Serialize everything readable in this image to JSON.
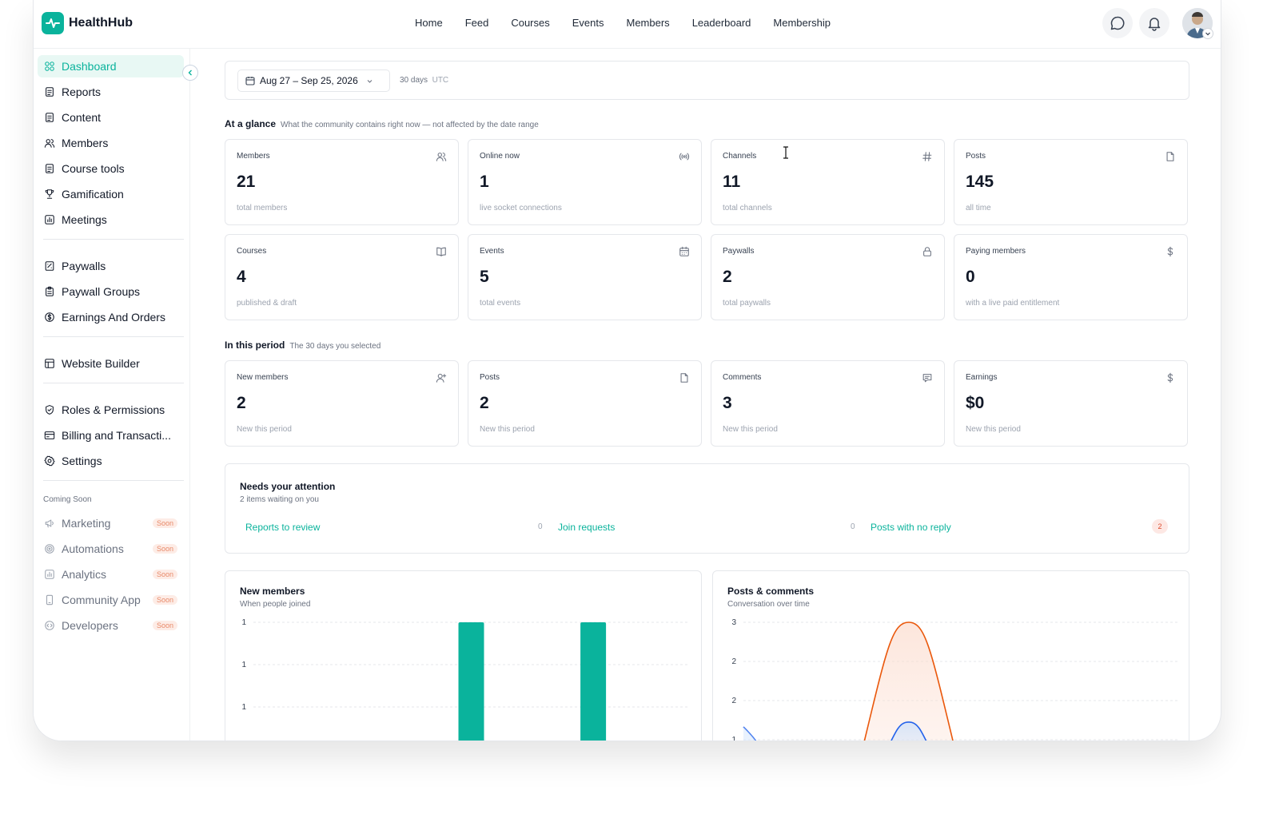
{
  "app": {
    "name": "HealthHub"
  },
  "nav": [
    "Home",
    "Feed",
    "Courses",
    "Events",
    "Members",
    "Leaderboard",
    "Membership"
  ],
  "header": {
    "chat_icon": "chat-bubble-icon",
    "bell_icon": "bell-icon"
  },
  "sidebar": {
    "groups": [
      [
        {
          "label": "Dashboard",
          "icon": "grid-icon",
          "active": true
        },
        {
          "label": "Reports",
          "icon": "document-icon"
        },
        {
          "label": "Content",
          "icon": "document-icon"
        },
        {
          "label": "Members",
          "icon": "users-icon"
        },
        {
          "label": "Course tools",
          "icon": "document-icon"
        },
        {
          "label": "Gamification",
          "icon": "trophy-icon"
        },
        {
          "label": "Meetings",
          "icon": "chart-icon"
        }
      ],
      [
        {
          "label": "Paywalls",
          "icon": "paywall-icon"
        },
        {
          "label": "Paywall Groups",
          "icon": "clipboard-icon"
        },
        {
          "label": "Earnings And Orders",
          "icon": "dollar-circle-icon"
        }
      ],
      [
        {
          "label": "Website Builder",
          "icon": "layout-icon"
        }
      ],
      [
        {
          "label": "Roles & Permissions",
          "icon": "shield-icon"
        },
        {
          "label": "Billing and Transacti...",
          "icon": "card-icon"
        },
        {
          "label": "Settings",
          "icon": "gear-icon"
        }
      ]
    ],
    "coming_soon_title": "Coming Soon",
    "soon_label": "Soon",
    "coming_soon": [
      {
        "label": "Marketing",
        "icon": "megaphone-icon"
      },
      {
        "label": "Automations",
        "icon": "target-icon"
      },
      {
        "label": "Analytics",
        "icon": "chart-icon"
      },
      {
        "label": "Community App",
        "icon": "phone-icon"
      },
      {
        "label": "Developers",
        "icon": "code-icon"
      }
    ]
  },
  "datebar": {
    "range": "Aug 27 – Sep 25, 2026",
    "days": "30 days",
    "tz": "UTC"
  },
  "glance": {
    "title": "At a glance",
    "subtitle": "What the community contains right now — not affected by the date range",
    "stats": [
      {
        "label": "Members",
        "value": "21",
        "sub": "total members",
        "icon": "users-icon"
      },
      {
        "label": "Online now",
        "value": "1",
        "sub": "live socket connections",
        "icon": "broadcast-icon"
      },
      {
        "label": "Channels",
        "value": "11",
        "sub": "total channels",
        "icon": "hash-icon"
      },
      {
        "label": "Posts",
        "value": "145",
        "sub": "all time",
        "icon": "file-icon"
      },
      {
        "label": "Courses",
        "value": "4",
        "sub": "published & draft",
        "icon": "book-icon"
      },
      {
        "label": "Events",
        "value": "5",
        "sub": "total events",
        "icon": "calendar-icon"
      },
      {
        "label": "Paywalls",
        "value": "2",
        "sub": "total paywalls",
        "icon": "lock-icon"
      },
      {
        "label": "Paying members",
        "value": "0",
        "sub": "with a live paid entitlement",
        "icon": "dollar-icon"
      }
    ]
  },
  "period": {
    "title": "In this period",
    "subtitle": "The 30 days you selected",
    "stats": [
      {
        "label": "New members",
        "value": "2",
        "sub": "New this period",
        "icon": "user-plus-icon"
      },
      {
        "label": "Posts",
        "value": "2",
        "sub": "New this period",
        "icon": "file-icon"
      },
      {
        "label": "Comments",
        "value": "3",
        "sub": "New this period",
        "icon": "comment-icon"
      },
      {
        "label": "Earnings",
        "value": "$0",
        "sub": "New this period",
        "icon": "dollar-icon"
      }
    ]
  },
  "attention": {
    "title": "Needs your attention",
    "subtitle": "2 items waiting on you",
    "items": [
      {
        "label": "Reports to review",
        "count": "0",
        "badge": false
      },
      {
        "label": "Join requests",
        "count": "0",
        "badge": false
      },
      {
        "label": "Posts with no reply",
        "count": "2",
        "badge": true
      }
    ]
  },
  "charts": {
    "members": {
      "title": "New members",
      "subtitle": "When people joined"
    },
    "posts": {
      "title": "Posts & comments",
      "subtitle": "Conversation over time"
    }
  },
  "chart_data": [
    {
      "type": "bar",
      "title": "New members",
      "subtitle": "When people joined",
      "y_tick_labels": [
        "1",
        "1",
        "1"
      ],
      "bars": [
        {
          "position": 0.5,
          "value": 1
        },
        {
          "position": 0.78,
          "value": 1
        }
      ],
      "ylim": [
        0,
        1
      ],
      "color": "#0ab39c",
      "grid": true
    },
    {
      "type": "area",
      "title": "Posts & comments",
      "subtitle": "Conversation over time",
      "y_tick_labels": [
        "3",
        "2",
        "2",
        "1"
      ],
      "series": [
        {
          "color": "#ea580c",
          "peak_value": 3,
          "peak_position": 0.38
        },
        {
          "color": "#2563eb",
          "peak_value": 1.3,
          "peak_position": 0.38
        }
      ],
      "ylim": [
        1,
        3
      ],
      "grid": true
    }
  ]
}
